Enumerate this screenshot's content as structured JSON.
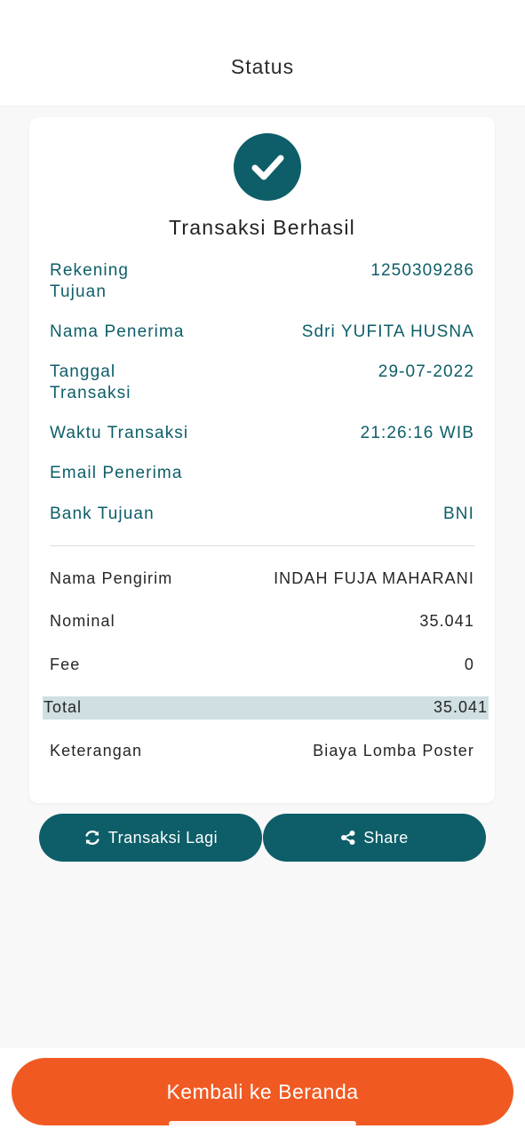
{
  "header": {
    "title": "Status"
  },
  "result": {
    "title": "Transaksi Berhasil",
    "icon": "check-circle-icon",
    "accent": "#0d5e68"
  },
  "recipient_details": [
    {
      "label": "Rekening\nTujuan",
      "value": "1250309286"
    },
    {
      "label": "Nama Penerima",
      "value": "Sdri YUFITA HUSNA"
    },
    {
      "label": "Tanggal\nTransaksi",
      "value": "29-07-2022"
    },
    {
      "label": "Waktu Transaksi",
      "value": "21:26:16 WIB"
    },
    {
      "label": "Email Penerima",
      "value": ""
    },
    {
      "label": "Bank Tujuan",
      "value": "BNI"
    }
  ],
  "summary": [
    {
      "label": "Nama Pengirim",
      "value": "INDAH FUJA MAHARANI"
    },
    {
      "label": "Nominal",
      "value": "35.041"
    },
    {
      "label": "Fee",
      "value": "0"
    }
  ],
  "total": {
    "label": "Total",
    "value": "35.041"
  },
  "note": {
    "label": "Keterangan",
    "value": "Biaya Lomba Poster"
  },
  "actions": {
    "again_label": "Transaksi Lagi",
    "again_icon": "refresh-icon",
    "share_label": "Share",
    "share_icon": "share-icon"
  },
  "footer": {
    "home_label": "Kembali ke Beranda",
    "home_color": "#f05a22"
  }
}
